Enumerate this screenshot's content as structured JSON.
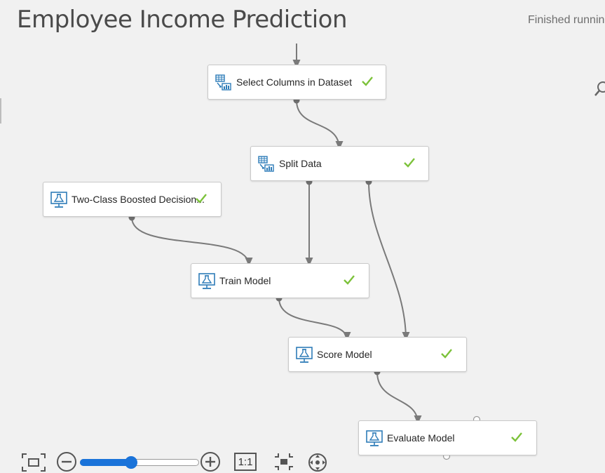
{
  "experiment": {
    "title": "Employee Income Prediction",
    "status": "Finished running"
  },
  "nodes": {
    "select_columns": {
      "label": "Select Columns in Dataset",
      "icon": "table-transform-icon",
      "status": "completed"
    },
    "split_data": {
      "label": "Split Data",
      "icon": "table-transform-icon",
      "status": "completed"
    },
    "two_class": {
      "label": "Two-Class Boosted Decision...",
      "icon": "flask-monitor-icon",
      "status": "completed"
    },
    "train_model": {
      "label": "Train Model",
      "icon": "flask-monitor-icon",
      "status": "completed"
    },
    "score_model": {
      "label": "Score Model",
      "icon": "flask-monitor-icon",
      "status": "completed"
    },
    "evaluate_model": {
      "label": "Evaluate Model",
      "icon": "flask-monitor-icon",
      "status": "completed"
    }
  },
  "zoom": {
    "one_to_one_label": "1:1",
    "level": 0.43
  },
  "colors": {
    "check": "#7cc23a",
    "accent": "#1a73d9",
    "icon": "#2e7cb8",
    "wire": "#7a7a7a"
  }
}
